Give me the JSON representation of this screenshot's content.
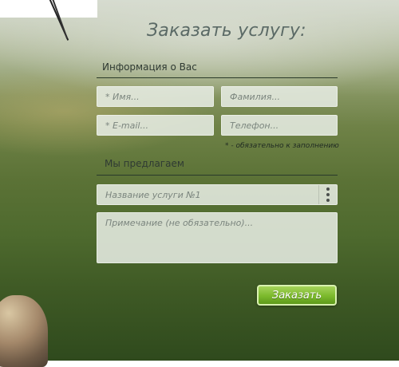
{
  "form": {
    "title": "Заказать услугу:",
    "info_section_label": "Информация о Вас",
    "fields": {
      "first_name_placeholder": "* Имя...",
      "last_name_placeholder": "Фамилия...",
      "email_placeholder": "* E-mail...",
      "phone_placeholder": "Телефон..."
    },
    "required_note": "* - обязательно к заполнению",
    "offer_section_label": "Мы предлагаем",
    "service_select_value": "Название услуги №1",
    "note_placeholder": "Примечание (не обязательно)...",
    "submit_label": "Заказать"
  }
}
